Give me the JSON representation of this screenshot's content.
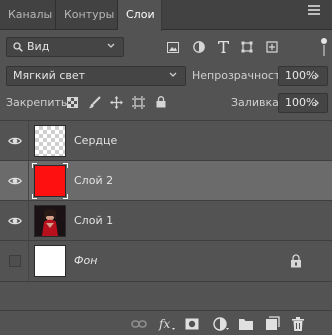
{
  "tabs": [
    {
      "label": "Каналы",
      "active": false
    },
    {
      "label": "Контуры",
      "active": false
    },
    {
      "label": "Слои",
      "active": true
    }
  ],
  "filter": {
    "kind_label": "Вид",
    "filter_icons": [
      "image-filter-icon",
      "adjustment-filter-icon",
      "type-filter-icon",
      "shape-filter-icon",
      "smart-object-filter-icon"
    ]
  },
  "blend": {
    "mode": "Мягкий свет",
    "opacity_label": "Непрозрачность:",
    "opacity_value": "100%"
  },
  "lock": {
    "label": "Закрепить:",
    "fill_label": "Заливка:",
    "fill_value": "100%"
  },
  "layers": [
    {
      "name": "Сердце",
      "visible": true,
      "selected": false,
      "thumb": "transparent"
    },
    {
      "name": "Слой 2",
      "visible": true,
      "selected": true,
      "thumb": "#ff1010"
    },
    {
      "name": "Слой 1",
      "visible": true,
      "selected": false,
      "thumb": "photo"
    },
    {
      "name": "Фон",
      "visible": false,
      "selected": false,
      "thumb": "#ffffff",
      "locked": true
    }
  ],
  "bottom_icons": [
    "link-layers-icon",
    "fx-icon",
    "mask-icon",
    "adjustment-layer-icon",
    "group-folder-icon",
    "new-layer-icon",
    "trash-icon"
  ],
  "colors": {
    "panel": "#535353",
    "tabbar": "#424242",
    "selected_row": "#6b6b6b",
    "layer2_fill": "#ff1010"
  }
}
